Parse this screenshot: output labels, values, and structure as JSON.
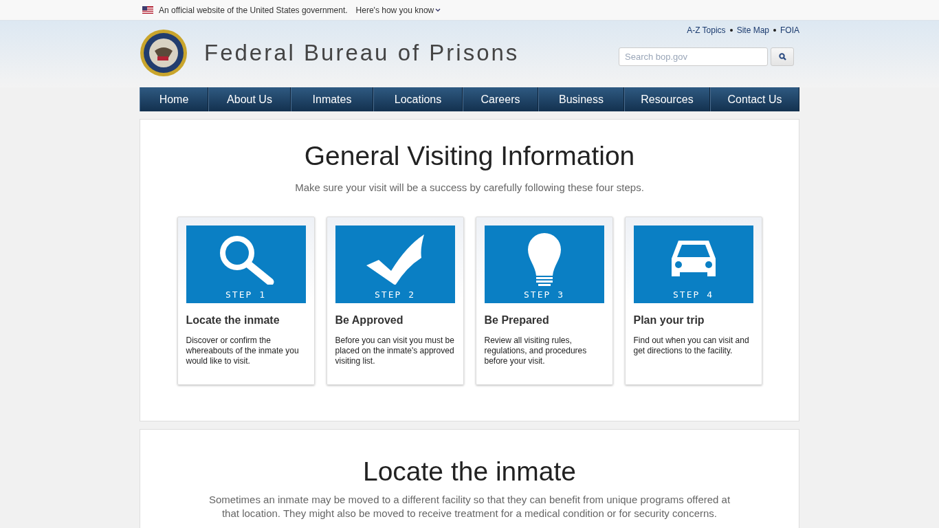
{
  "gov_banner": {
    "text": "An official website of the United States government.",
    "link": "Here's how you know"
  },
  "header": {
    "title": "Federal Bureau of Prisons",
    "utility_links": [
      "A-Z Topics",
      "Site Map",
      "FOIA"
    ],
    "search": {
      "placeholder": "Search bop.gov"
    }
  },
  "nav": [
    {
      "label": "Home"
    },
    {
      "label": "About Us"
    },
    {
      "label": "Inmates"
    },
    {
      "label": "Locations"
    },
    {
      "label": "Careers"
    },
    {
      "label": "Business"
    },
    {
      "label": "Resources"
    },
    {
      "label": "Contact Us"
    }
  ],
  "intro": {
    "title": "General Visiting Information",
    "subtitle": "Make sure your visit will be a success by carefully following these four steps.",
    "steps": [
      {
        "step": "STEP 1",
        "title": "Locate the inmate",
        "text": "Discover or confirm the whereabouts of the inmate you would like to visit."
      },
      {
        "step": "STEP 2",
        "title": "Be Approved",
        "text": "Before you can visit you must be placed on the inmate's approved visiting list."
      },
      {
        "step": "STEP 3",
        "title": "Be Prepared",
        "text": "Review all visiting rules, regulations, and procedures before your visit."
      },
      {
        "step": "STEP 4",
        "title": "Plan your trip",
        "text": "Find out when you can visit and get directions to the facility."
      }
    ]
  },
  "locate": {
    "title": "Locate the inmate",
    "text": "Sometimes an inmate may be moved to a different facility so that they can benefit from unique programs offered at that location. They might also be moved to receive treatment for a medical condition or for security concerns."
  }
}
